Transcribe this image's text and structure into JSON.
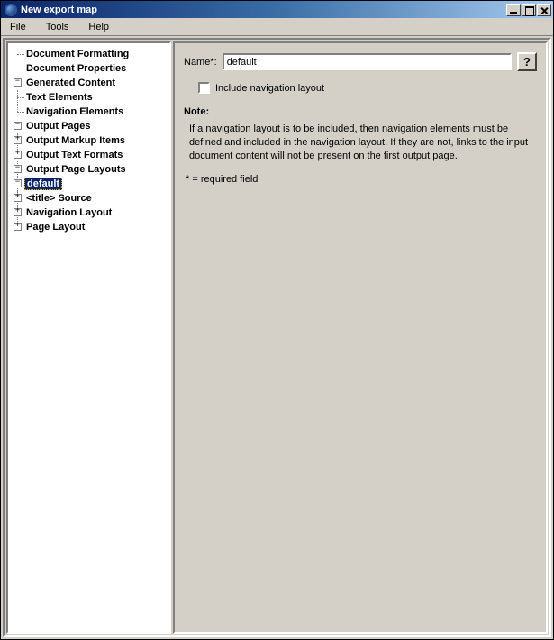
{
  "window": {
    "title": "New export map"
  },
  "menu": {
    "file": "File",
    "tools": "Tools",
    "help": "Help"
  },
  "tree": {
    "doc_formatting": "Document Formatting",
    "doc_properties": "Document Properties",
    "generated_content": "Generated Content",
    "text_elements": "Text Elements",
    "navigation_elements": "Navigation Elements",
    "output_pages": "Output Pages",
    "output_markup_items": "Output Markup Items",
    "output_text_formats": "Output Text Formats",
    "output_page_layouts": "Output Page Layouts",
    "default": "default",
    "title_source": "<title> Source",
    "navigation_layout": "Navigation Layout",
    "page_layout": "Page Layout"
  },
  "form": {
    "name_label": "Name*:",
    "name_value": "default",
    "include_nav_label": "Include navigation layout",
    "include_nav_checked": false,
    "note_label": "Note:",
    "note_body": "If a navigation layout is to be included, then navigation elements must be defined and included in the navigation layout. If they are not, links to the input document content will not be present on the first output page.",
    "required_note": "* = required field",
    "help_label": "?"
  }
}
